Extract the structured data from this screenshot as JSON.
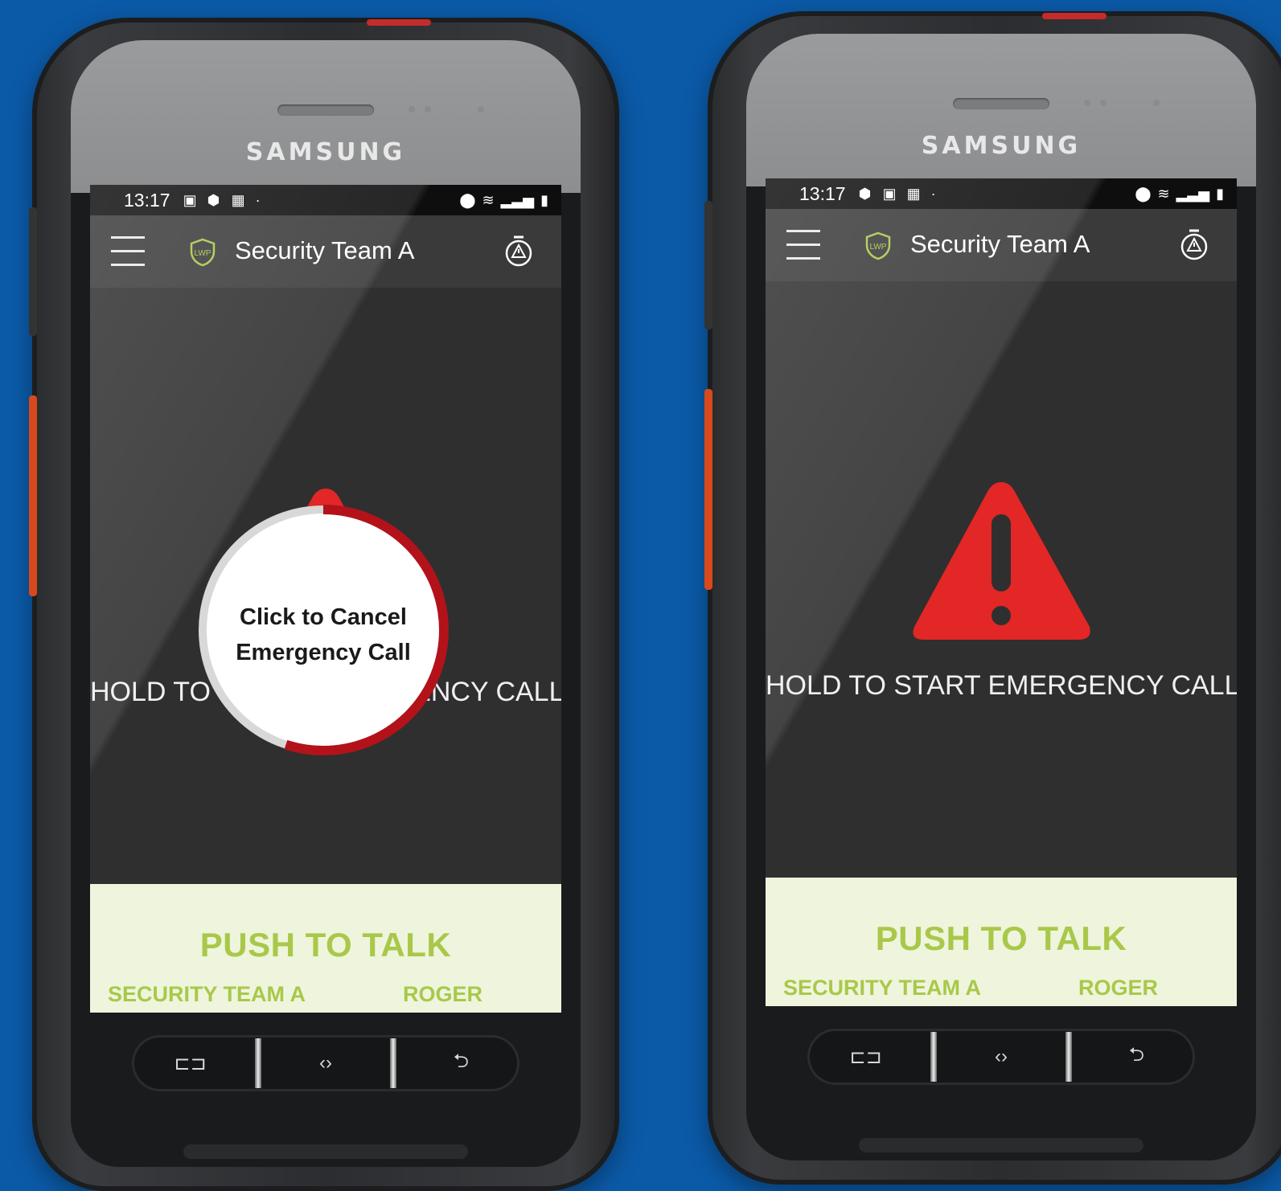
{
  "phones": [
    {
      "brand": "SAMSUNG",
      "status": {
        "time": "13:17"
      },
      "app": {
        "title": "Security Team A",
        "logo_text": "LWP"
      },
      "emergency": {
        "hold_text": "HOLD TO START EMERGENCY CALL",
        "cancel_text_line1": "Click to Cancel",
        "cancel_text_line2": "Emergency Call",
        "hold_progress": 0.55
      },
      "ptt": {
        "title": "PUSH TO TALK",
        "channel": "SECURITY TEAM A",
        "user": "ROGER"
      },
      "nav": {
        "recents": "⊏⊐",
        "home": "‹›",
        "back": "⮌"
      }
    },
    {
      "brand": "SAMSUNG",
      "status": {
        "time": "13:17"
      },
      "app": {
        "title": "Security Team A",
        "logo_text": "LWP"
      },
      "emergency": {
        "hold_text": "HOLD TO START EMERGENCY CALL"
      },
      "ptt": {
        "title": "PUSH TO TALK",
        "channel": "SECURITY TEAM A",
        "user": "ROGER"
      },
      "nav": {
        "recents": "⊏⊐",
        "home": "‹›",
        "back": "⮌"
      }
    }
  ],
  "colors": {
    "background": "#0b5aa8",
    "accent_green": "#a9c84a",
    "ptt_background": "#eef5dc",
    "alert_red": "#e32626",
    "progress_red": "#b3121a"
  }
}
